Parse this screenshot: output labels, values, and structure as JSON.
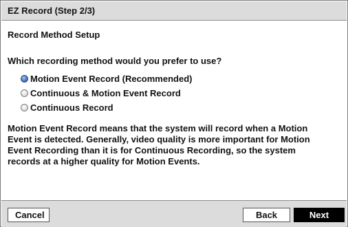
{
  "window": {
    "title": "EZ Record (Step 2/3)"
  },
  "content": {
    "subtitle": "Record Method Setup",
    "question": "Which recording method would you prefer to use?",
    "options": [
      {
        "label": "Motion Event Record (Recommended)",
        "selected": true
      },
      {
        "label": "Continuous & Motion Event Record",
        "selected": false
      },
      {
        "label": "Continuous Record",
        "selected": false
      }
    ],
    "description_lines": [
      "Motion Event Record means that the system will record when a Motion",
      "Event is detected. Generally, video quality is more important for Motion",
      "Event Recording than it is for Continuous Recording, so the system",
      "records at a higher quality for Motion Events."
    ]
  },
  "footer": {
    "cancel_label": "Cancel",
    "back_label": "Back",
    "next_label": "Next"
  },
  "colors": {
    "title_bar": "#dcdcdc",
    "selected_radio": "#4f78c0",
    "primary_button": "#000000"
  }
}
